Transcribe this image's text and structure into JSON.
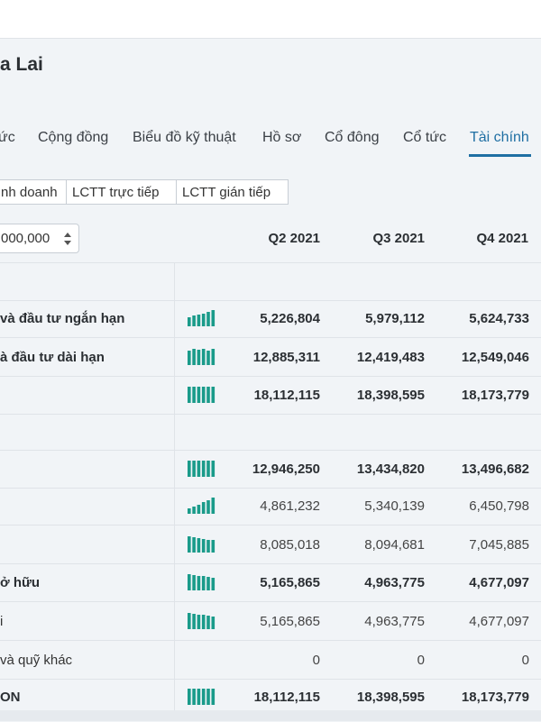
{
  "title": "a Lai",
  "tabs": [
    {
      "label": "ức",
      "active": false
    },
    {
      "label": "Cộng đồng",
      "active": false
    },
    {
      "label": "Biểu đồ kỹ thuật",
      "active": false
    },
    {
      "label": "Hồ sơ",
      "active": false
    },
    {
      "label": "Cổ đông",
      "active": false
    },
    {
      "label": "Cổ tức",
      "active": false
    },
    {
      "label": "Tài chính",
      "active": true
    }
  ],
  "subtabs": [
    "nh doanh",
    "LCTT trực tiếp",
    "LCTT gián tiếp"
  ],
  "unit_select": {
    "value": "000,000"
  },
  "columns": [
    "Q2 2021",
    "Q3 2021",
    "Q4 2021"
  ],
  "rows": [
    {
      "label": "",
      "bold": false,
      "values": [
        "",
        "",
        ""
      ],
      "spark": false
    },
    {
      "label": "và đầu tư ngắn hạn",
      "bold": true,
      "values": [
        "5,226,804",
        "5,979,112",
        "5,624,733"
      ],
      "spark": true
    },
    {
      "label": "à đầu tư dài hạn",
      "bold": true,
      "values": [
        "12,885,311",
        "12,419,483",
        "12,549,046"
      ],
      "spark": true
    },
    {
      "label": "",
      "bold": true,
      "values": [
        "18,112,115",
        "18,398,595",
        "18,173,779"
      ],
      "spark": true
    },
    {
      "label": "",
      "bold": false,
      "values": [
        "",
        "",
        ""
      ],
      "spark": false
    },
    {
      "label": "",
      "bold": true,
      "values": [
        "12,946,250",
        "13,434,820",
        "13,496,682"
      ],
      "spark": true
    },
    {
      "label": "",
      "bold": false,
      "values": [
        "4,861,232",
        "5,340,139",
        "6,450,798"
      ],
      "spark": true
    },
    {
      "label": "",
      "bold": false,
      "values": [
        "8,085,018",
        "8,094,681",
        "7,045,885"
      ],
      "spark": true
    },
    {
      "label": "ở hữu",
      "bold": true,
      "values": [
        "5,165,865",
        "4,963,775",
        "4,677,097"
      ],
      "spark": true
    },
    {
      "label": "i",
      "bold": false,
      "values": [
        "5,165,865",
        "4,963,775",
        "4,677,097"
      ],
      "spark": true
    },
    {
      "label": "và quỹ khác",
      "bold": false,
      "values": [
        "0",
        "0",
        "0"
      ],
      "spark": false
    },
    {
      "label": "ON",
      "bold": true,
      "values": [
        "18,112,115",
        "18,398,595",
        "18,173,779"
      ],
      "spark": true
    }
  ],
  "colors": {
    "accent": "#1f6fa3",
    "spark": "#1a9b8a"
  }
}
